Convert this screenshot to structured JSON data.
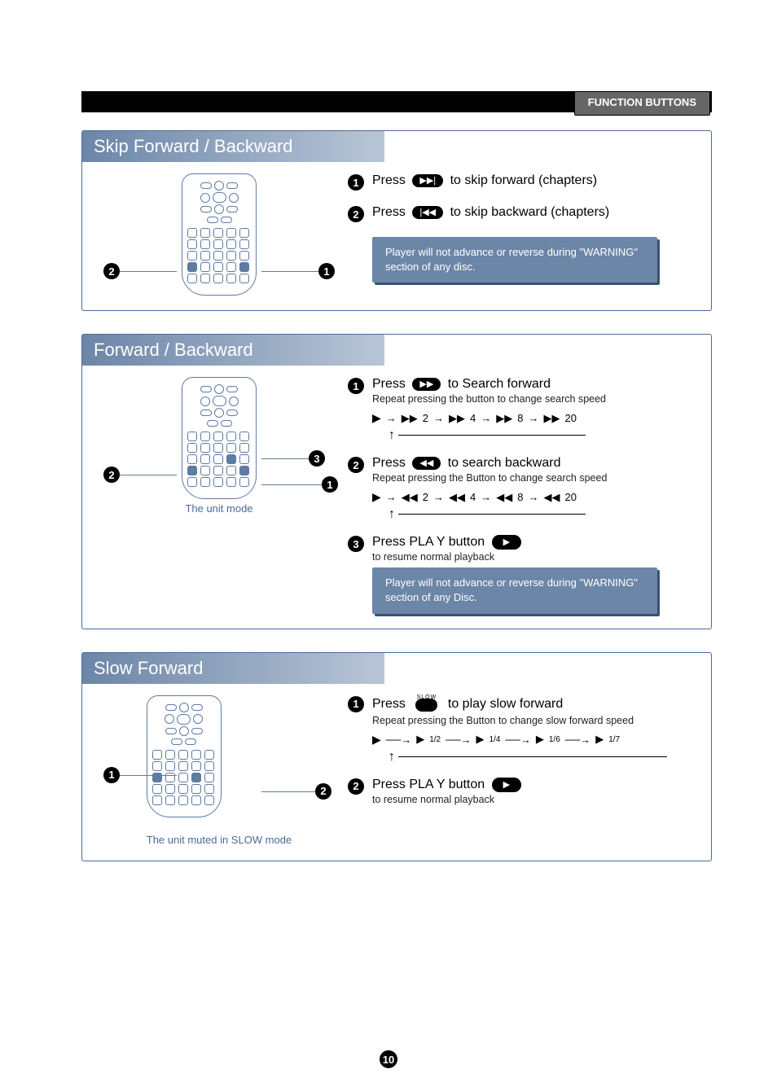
{
  "header": {
    "func_buttons": "FUNCTION BUTTONS"
  },
  "skip": {
    "title": "Skip Forward / Backward",
    "step1": "to skip forward (chapters)",
    "step2": "to skip backward (chapters)",
    "press": "Press",
    "note": "Player will not advance or reverse during \"WARNING\" section of any disc."
  },
  "fwd": {
    "title": "Forward / Backward",
    "caption": "The unit  mode",
    "press": "Press",
    "step1_a": "to Search forward",
    "step1_b": "Repeat pressing the button to change search speed",
    "step2_a": "to search backward",
    "step2_b": "Repeat pressing the Button to change search speed",
    "step3_a": "Press PLA Y  button",
    "step3_b": "to resume normal playback",
    "note": "Player will not advance or reverse during \"WARNING\" section of any Disc.",
    "speeds_fwd": [
      "2",
      "4",
      "8",
      "20"
    ],
    "speeds_bwd": [
      "2",
      "4",
      "8",
      "20"
    ]
  },
  "slow": {
    "title": "Slow Forward",
    "caption": "The unit muted in SLOW mode",
    "press": "Press",
    "slow_label": "SLOW",
    "step1_a": "to play slow forward",
    "step1_b": "Repeat pressing the Button to change slow forward speed",
    "step2_a": "Press PLA Y button",
    "step2_b": "to resume normal playback",
    "fracs": [
      "1/2",
      "1/4",
      "1/6",
      "1/7"
    ]
  },
  "page": "10"
}
